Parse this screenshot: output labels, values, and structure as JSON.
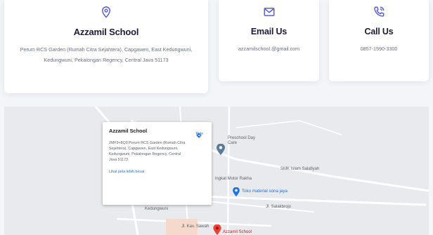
{
  "cards": {
    "address": {
      "title": "Azzamil School",
      "text": "Perum RCS Garden (Rumah Citra Sejahtera), Capgawen, East Kedungwuni, Kedungwuni, Pekalongan Regency, Central Java 51173",
      "icon": "map-pin-icon"
    },
    "email": {
      "title": "Email Us",
      "text": "azzamilschool.@gmail.com",
      "icon": "envelope-icon"
    },
    "phone": {
      "title": "Call Us",
      "text": "0857-1590-3300",
      "icon": "phone-call-icon"
    }
  },
  "accent_color": "#5b5fe0",
  "map": {
    "infowindow": {
      "name": "Azzamil School",
      "address": "2MF9+8Q9 Perum RCS Garden (Rumah Citra Sejahtera), Capgawen, East Kedungwuni, Kedungwuni, Pekalongan Regency, Central Java 51173",
      "directions_label": "Rute",
      "larger_map_link": "Lihat peta lebih besar"
    },
    "labels": {
      "preschool": "Preschool Day Care",
      "motor": "ingkat Motor Rakha",
      "smk": "SMK Islam Salafiyah",
      "toko": "Toko material sona jaya",
      "kedungwuni": "Kedungwuni",
      "salakbrojo": "Jl. Salakbrojo",
      "kav": "Jl. Kav. Sawah",
      "azzamil_marker": "Azzamil School"
    }
  }
}
